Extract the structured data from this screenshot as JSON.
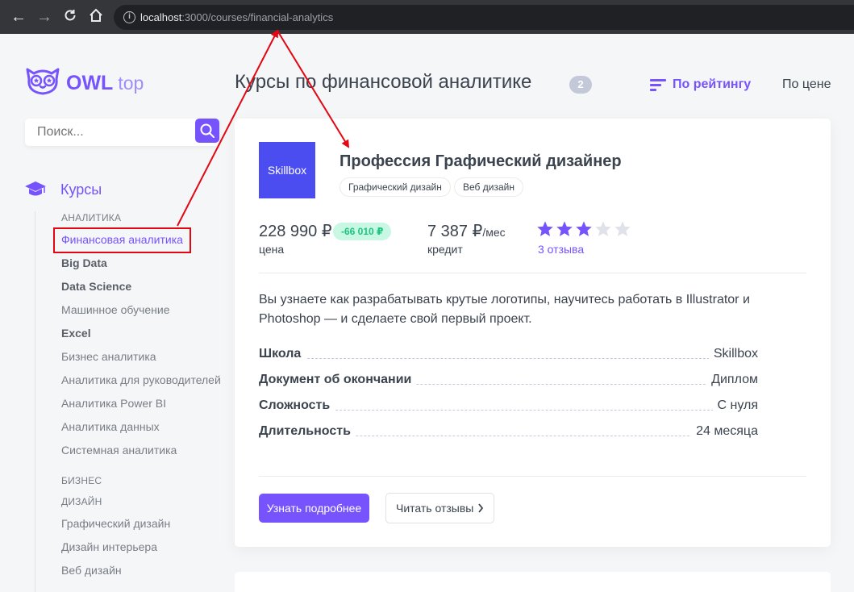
{
  "browser": {
    "url_host": "localhost",
    "url_rest": ":3000/courses/financial-analytics",
    "info_icon": "i"
  },
  "logo": {
    "name": "OWL",
    "suffix": "top"
  },
  "search": {
    "placeholder": "Поиск..."
  },
  "sidebar": {
    "category": "Курсы",
    "items": [
      {
        "label": "АНАЛИТИКА",
        "kind": "section"
      },
      {
        "label": "Финансовая аналитика",
        "kind": "active"
      },
      {
        "label": "Big Data",
        "kind": "bold"
      },
      {
        "label": "Data Science",
        "kind": "bold"
      },
      {
        "label": "Машинное обучение",
        "kind": "normal"
      },
      {
        "label": "Excel",
        "kind": "bold"
      },
      {
        "label": "Бизнес аналитика",
        "kind": "normal"
      },
      {
        "label": "Аналитика для руководителей",
        "kind": "normal"
      },
      {
        "label": "Аналитика Power BI",
        "kind": "normal"
      },
      {
        "label": "Аналитика данных",
        "kind": "normal"
      },
      {
        "label": "Системная аналитика",
        "kind": "normal"
      },
      {
        "label": "БИЗНЕС",
        "kind": "section"
      },
      {
        "label": "ДИЗАЙН",
        "kind": "section"
      },
      {
        "label": "Графический дизайн",
        "kind": "normal"
      },
      {
        "label": "Дизайн интерьера",
        "kind": "normal"
      },
      {
        "label": "Веб дизайн",
        "kind": "normal"
      }
    ]
  },
  "header": {
    "title": "Курсы по финансовой аналитике",
    "count": "2",
    "sort_rating": "По рейтингу",
    "sort_price": "По цене"
  },
  "course": {
    "logo_text": "Skillbox",
    "title": "Профессия Графический дизайнер",
    "tags": [
      "Графический дизайн",
      "Веб дизайн"
    ],
    "price": "228 990 ₽",
    "discount": "-66 010 ₽",
    "price_label": "цена",
    "credit": "7 387 ₽",
    "credit_unit": "/мес",
    "credit_label": "кредит",
    "rating": 3,
    "rating_max": 5,
    "reviews": "3 отзыва",
    "description": "Вы узнаете как разрабатывать крутые логотипы, научитесь работать в Illustrator и Photoshop — и сделаете свой первый проект.",
    "features": [
      {
        "key": "Школа",
        "value": "Skillbox"
      },
      {
        "key": "Документ об окончании",
        "value": "Диплом"
      },
      {
        "key": "Сложность",
        "value": "С нуля"
      },
      {
        "key": "Длительность",
        "value": "24 месяца"
      }
    ],
    "more_button": "Узнать подробнее",
    "reviews_button": "Читать отзывы"
  },
  "colors": {
    "accent": "#7653fc",
    "discount_bg": "#c8f8e4",
    "discount_text": "#1dc37e",
    "star_filled": "#7653fc",
    "star_empty": "#dfe2e8",
    "annotation": "#e30613"
  }
}
